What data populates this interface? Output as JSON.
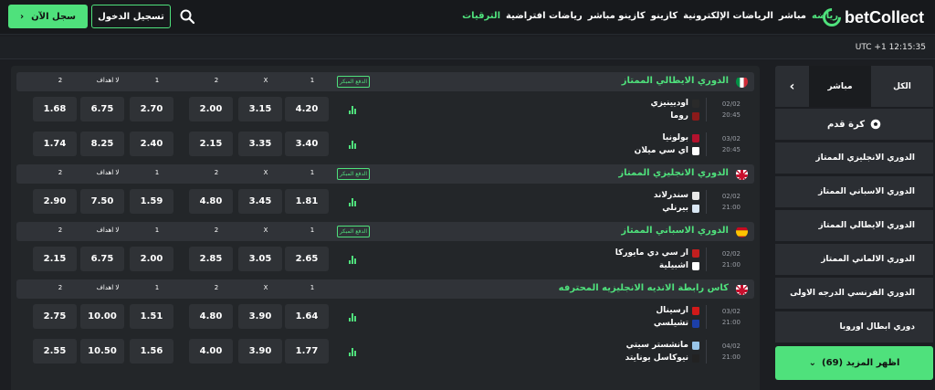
{
  "header": {
    "logo": "betCollect",
    "nav": [
      "رياضه",
      "مباشر",
      "الرياضات الإلكترونية",
      "كازينو",
      "كازينو مباشر",
      "رياضات افتراضية",
      "الترقيات"
    ],
    "login_label": "تسجيل الدخول",
    "register_label": "سجل الآن"
  },
  "clock": "UTC +1 12:15:35",
  "sidebar": {
    "tab_all": "الكل",
    "tab_live": "مباشر",
    "sport": "كرة قدم",
    "leagues": [
      "الدوري الانجليزي الممتاز",
      "الدوري الاسباني الممتاز",
      "الدوري الايطالي الممتاز",
      "الدوري الالماني الممتاز",
      "الدوري الفرنسي الدرجه الاولى",
      "دوري ابطال اوروبا"
    ],
    "show_more": "اظهر المزيد (69)"
  },
  "columns": [
    "1",
    "X",
    "2",
    "1",
    "لا اهداف",
    "2"
  ],
  "early_payout": "الدفع المبكر",
  "colors": {
    "accent": "#4fe17c"
  },
  "leagues": [
    {
      "name": "الدوري الايطالي الممتاز",
      "flag": "italy",
      "badge": true,
      "matches": [
        {
          "date": "02/02",
          "time": "20:45",
          "home": "اوديينيزي",
          "away": "روما",
          "home_kit": "#2a2a2a",
          "away_kit": "#8b1a1a",
          "odds": [
            "4.20",
            "3.15",
            "2.00",
            "2.70",
            "6.75",
            "1.68"
          ]
        },
        {
          "date": "03/02",
          "time": "20:45",
          "home": "بولونيا",
          "away": "اي سي ميلان",
          "home_kit": "#b3122e",
          "away_kit": "#ffffff",
          "odds": [
            "3.40",
            "3.35",
            "2.15",
            "2.40",
            "8.25",
            "1.74"
          ]
        }
      ]
    },
    {
      "name": "الدوري الانجليزي الممتاز",
      "flag": "england",
      "badge": true,
      "matches": [
        {
          "date": "02/02",
          "time": "21:00",
          "home": "سندرلاند",
          "away": "بيرنلي",
          "home_kit": "#e8e8e8",
          "away_kit": "#d8e6f3",
          "odds": [
            "1.81",
            "3.45",
            "4.80",
            "1.59",
            "7.50",
            "2.90"
          ]
        }
      ]
    },
    {
      "name": "الدوري الاسباني الممتاز",
      "flag": "spain",
      "badge": true,
      "matches": [
        {
          "date": "02/02",
          "time": "21:00",
          "home": "ار سي دي مايوركا",
          "away": "اشبيلية",
          "home_kit": "#c21f1f",
          "away_kit": "#ffffff",
          "odds": [
            "2.65",
            "3.05",
            "2.85",
            "2.00",
            "6.75",
            "2.15"
          ]
        }
      ]
    },
    {
      "name": "كاس رابطة الانديه الانجليزيه المحترفه",
      "flag": "england",
      "badge": false,
      "matches": [
        {
          "date": "03/02",
          "time": "21:00",
          "home": "ارسينال",
          "away": "تشيلسي",
          "home_kit": "#d11919",
          "away_kit": "#1c3fa8",
          "odds": [
            "1.64",
            "3.90",
            "4.80",
            "1.51",
            "10.00",
            "2.75"
          ]
        },
        {
          "date": "04/02",
          "time": "21:00",
          "home": "مانشستر سيتي",
          "away": "نيوكاسل يونايتد",
          "home_kit": "#98c5e9",
          "away_kit": "#222222",
          "odds": [
            "1.77",
            "3.90",
            "4.00",
            "1.56",
            "10.50",
            "2.55"
          ]
        }
      ]
    }
  ]
}
